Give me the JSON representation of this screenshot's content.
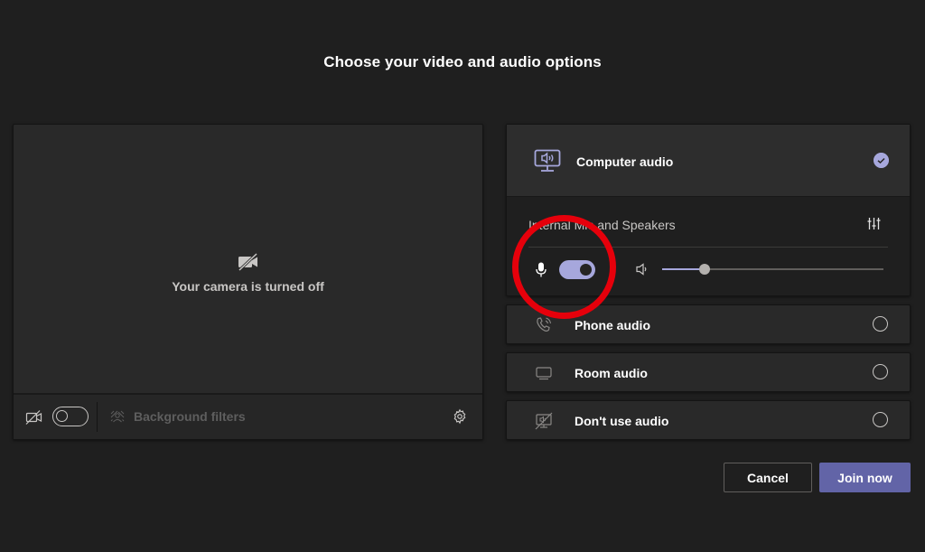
{
  "page": {
    "title": "Choose your video and audio options"
  },
  "video": {
    "camera_off_message": "Your camera is turned off",
    "camera_toggle_on": false,
    "background_filters_label": "Background filters",
    "icons": {
      "camera_off": "camera-off-icon",
      "background_filters": "background-blur-icon",
      "settings": "gear-icon"
    }
  },
  "audio": {
    "selected_option": {
      "label": "Computer audio",
      "icon": "monitor-speaker-icon",
      "selected": true
    },
    "device_label": "Internal Mic and Speakers",
    "mic_toggle_on": true,
    "speaker_volume_percent": 19,
    "options": [
      {
        "label": "Phone audio",
        "icon": "phone-icon",
        "selected": false
      },
      {
        "label": "Room audio",
        "icon": "room-display-icon",
        "selected": false
      },
      {
        "label": "Don't use audio",
        "icon": "no-audio-icon",
        "selected": false
      }
    ]
  },
  "actions": {
    "cancel_label": "Cancel",
    "join_label": "Join now"
  },
  "colors": {
    "accent": "#6264a7",
    "accent_light": "#a6a7dc",
    "annotation": "#e6000b",
    "background": "#1f1f1f"
  }
}
